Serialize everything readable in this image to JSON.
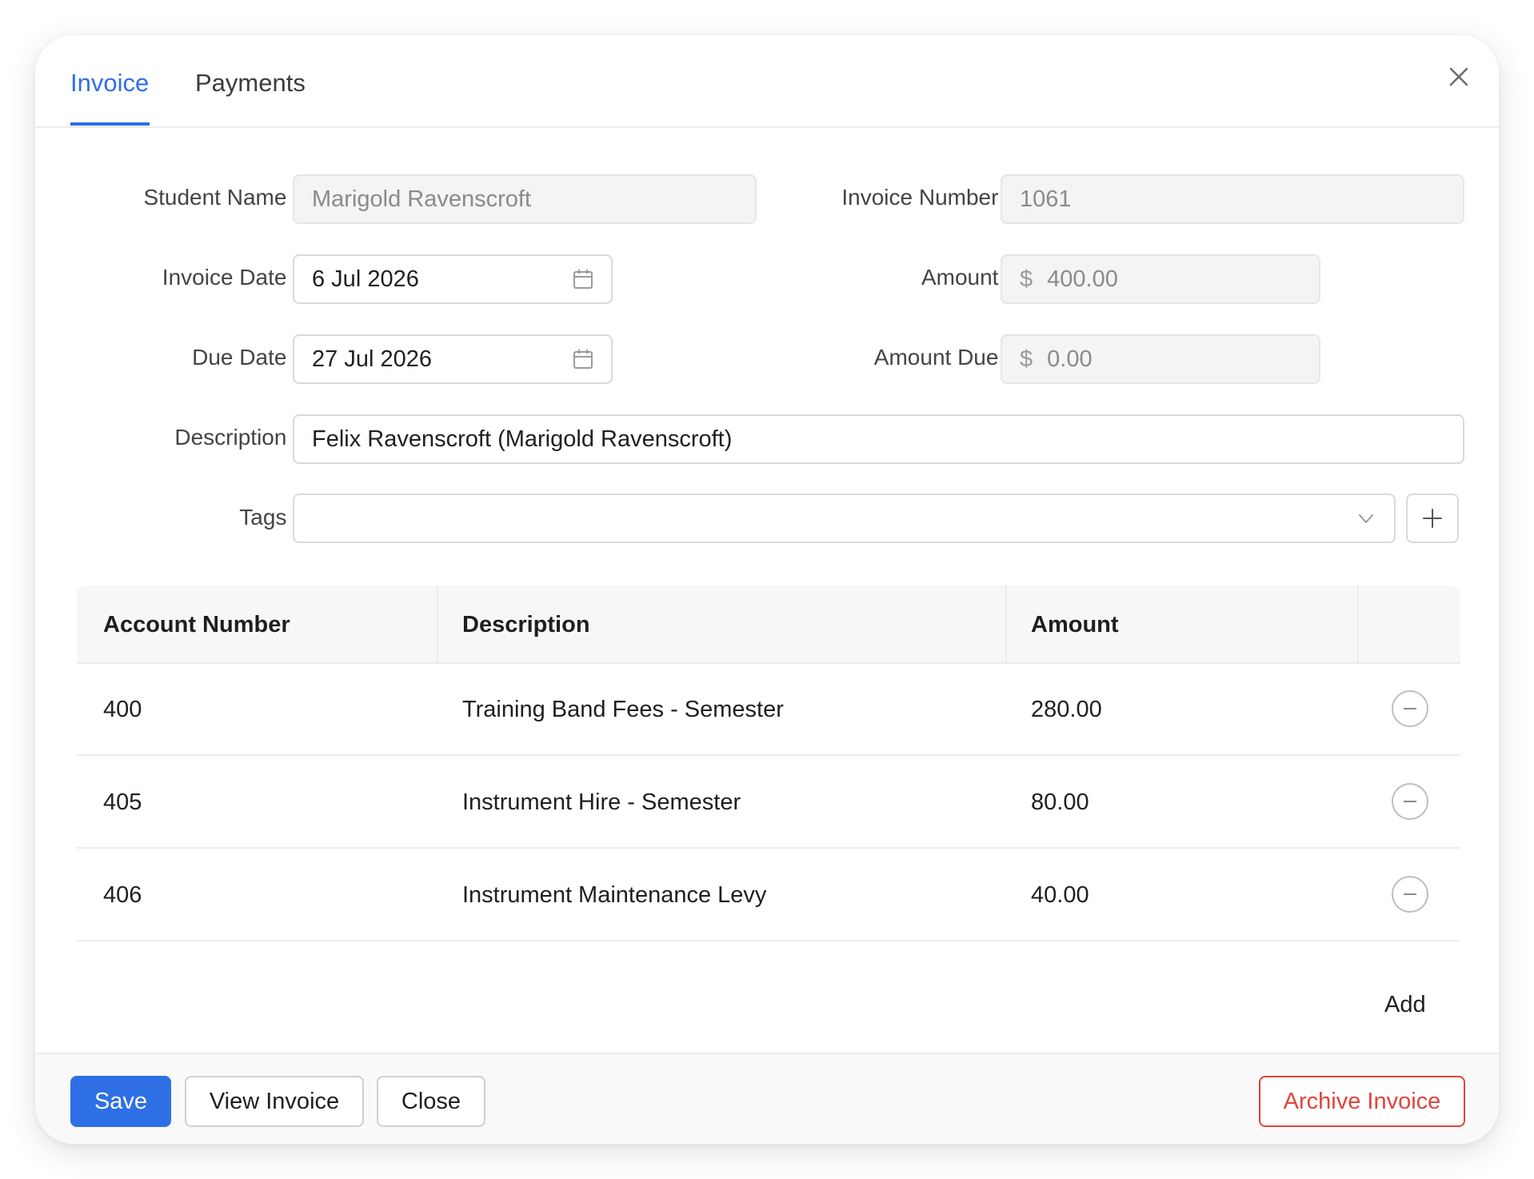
{
  "tabs": [
    {
      "label": "Invoice",
      "active": true
    },
    {
      "label": "Payments",
      "active": false
    }
  ],
  "form": {
    "student_name": {
      "label": "Student Name :",
      "value": "Marigold Ravenscroft"
    },
    "invoice_number": {
      "label": "Invoice Number :",
      "value": "1061"
    },
    "invoice_date": {
      "label": "Invoice Date :",
      "value": "6 Jul 2026"
    },
    "amount": {
      "label": "Amount :",
      "prefix": "$",
      "value": "400.00"
    },
    "due_date": {
      "label": "Due Date :",
      "value": "27 Jul 2026"
    },
    "amount_due": {
      "label": "Amount Due :",
      "prefix": "$",
      "value": "0.00"
    },
    "description": {
      "label": "Description :",
      "value": "Felix Ravenscroft (Marigold Ravenscroft)"
    },
    "tags": {
      "label": "Tags :",
      "value": ""
    }
  },
  "table": {
    "headers": [
      "Account Number",
      "Description",
      "Amount"
    ],
    "rows": [
      {
        "account": "400",
        "description": "Training Band Fees - Semester",
        "amount": "280.00"
      },
      {
        "account": "405",
        "description": "Instrument Hire - Semester",
        "amount": "80.00"
      },
      {
        "account": "406",
        "description": "Instrument Maintenance Levy",
        "amount": "40.00"
      }
    ],
    "add_label": "Add"
  },
  "footer": {
    "save_label": "Save",
    "view_invoice_label": "View Invoice",
    "close_label": "Close",
    "archive_label": "Archive Invoice"
  },
  "colors": {
    "accent": "#2f6fe6",
    "danger": "#e0443c"
  },
  "icons": [
    "close-icon",
    "calendar-icon",
    "chevron-down-icon",
    "plus-icon",
    "minus-circle-icon"
  ]
}
